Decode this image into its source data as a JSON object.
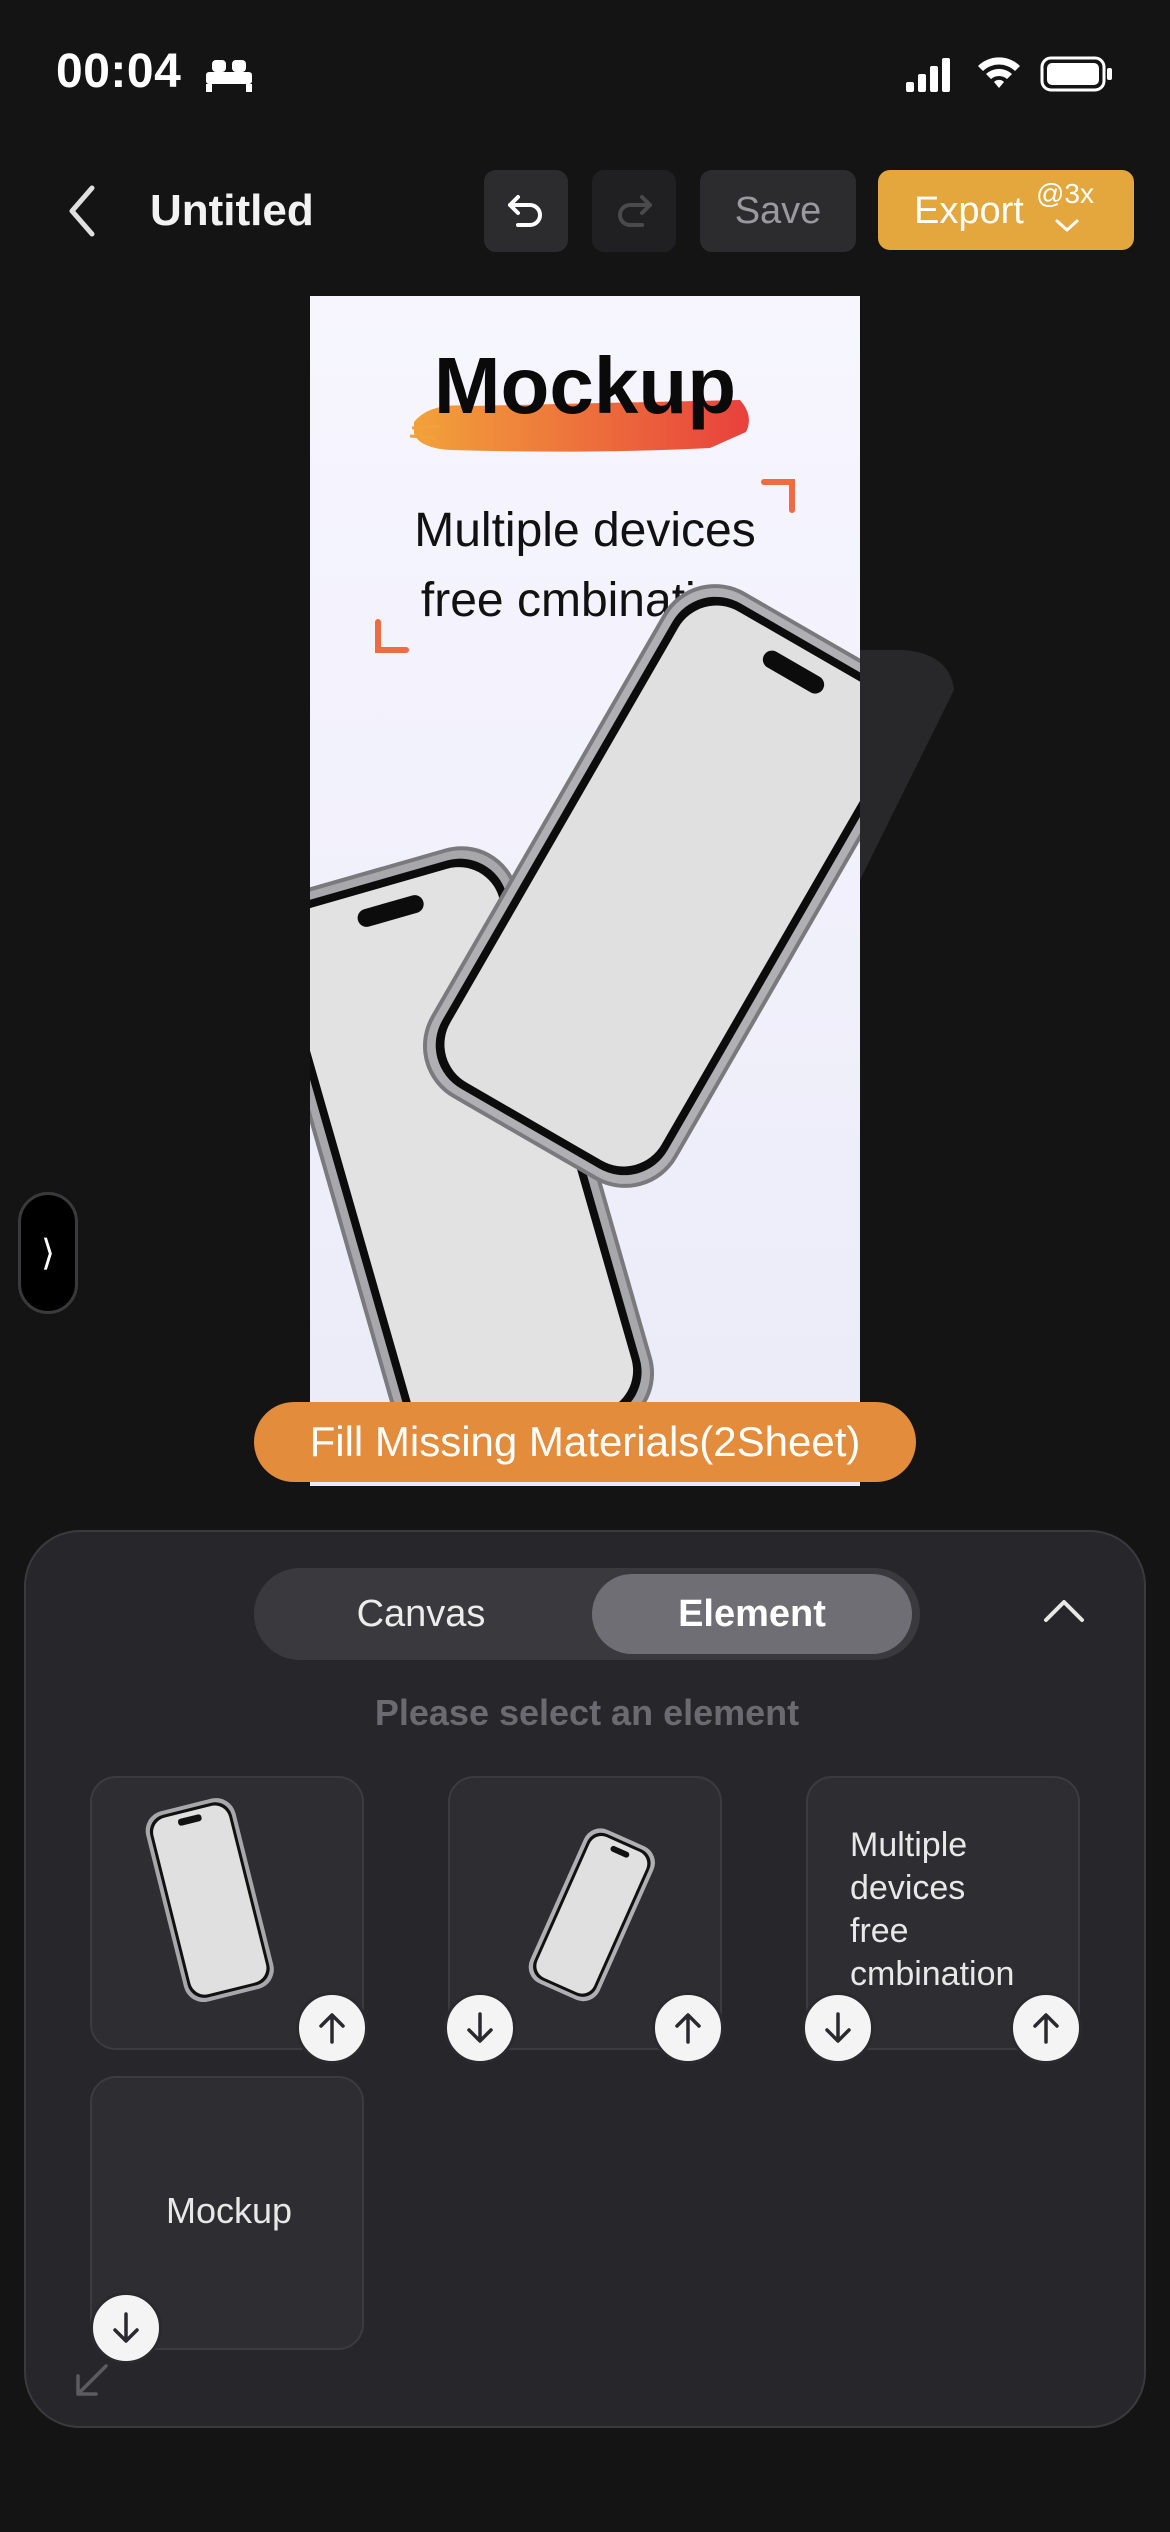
{
  "status_bar": {
    "time": "00:04"
  },
  "toolbar": {
    "title": "Untitled",
    "save_label": "Save",
    "export_label": "Export",
    "export_scale": "@3x"
  },
  "canvas": {
    "title": "Mockup",
    "subtitle_line1": "Multiple devices",
    "subtitle_line2": "free cmbination",
    "fill_button": "Fill Missing Materials(2Sheet)"
  },
  "panel": {
    "tabs": {
      "canvas": "Canvas",
      "element": "Element"
    },
    "hint": "Please select an element",
    "elements": {
      "text_layer_lines": [
        "Multiple",
        "devices",
        "free",
        "cmbination"
      ],
      "mockup_layer": "Mockup"
    }
  },
  "colors": {
    "accent": "#e4a73d",
    "fill_button": "#e38c3b",
    "brush_start": "#f2a23a",
    "brush_end": "#e8413d",
    "panel_bg": "#27272b",
    "app_bg": "#141414"
  },
  "icons": [
    "sleep-icon",
    "signal-icon",
    "wifi-icon",
    "battery-icon",
    "back-icon",
    "undo-icon",
    "redo-icon",
    "chevron-down-icon",
    "chevron-up-icon",
    "arrow-up-icon",
    "arrow-down-icon",
    "resize-icon"
  ]
}
